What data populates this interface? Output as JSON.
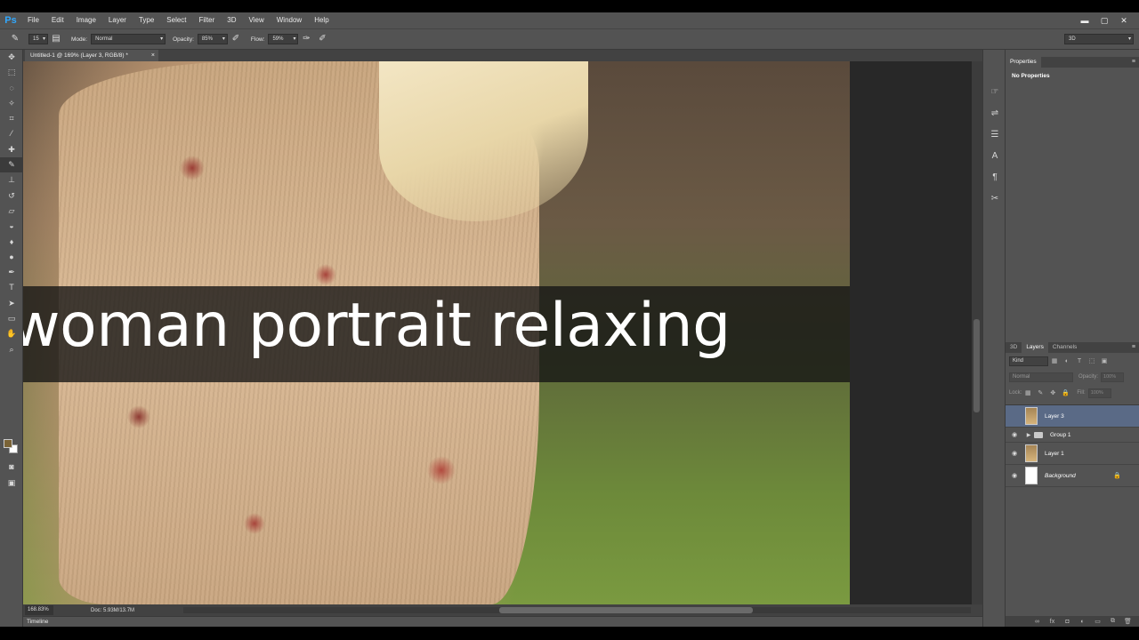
{
  "app": {
    "logo": "Ps"
  },
  "menu": [
    "File",
    "Edit",
    "Image",
    "Layer",
    "Type",
    "Select",
    "Filter",
    "3D",
    "View",
    "Window",
    "Help"
  ],
  "window_controls": [
    "▬",
    "▢",
    "✕"
  ],
  "options": {
    "brush_size": "15",
    "mode_label": "Mode:",
    "mode_value": "Normal",
    "opacity_label": "Opacity:",
    "opacity_value": "85%",
    "flow_label": "Flow:",
    "flow_value": "59%",
    "workspace": "3D"
  },
  "document": {
    "tab_title": "Untitled-1 @ 169% (Layer 3, RGB/8) *",
    "caption": "woman portrait relaxing"
  },
  "status": {
    "zoom": "168.83%",
    "doc_size": "Doc: 5.93M/13.7M"
  },
  "timeline": {
    "label": "Timeline"
  },
  "properties": {
    "tab": "Properties",
    "empty_text": "No Properties"
  },
  "layers_panel": {
    "tabs": [
      "3D",
      "Layers",
      "Channels"
    ],
    "filter_kind": "Kind",
    "blend_mode": "Normal",
    "opacity_label": "Opacity:",
    "opacity_value": "100%",
    "lock_label": "Lock:",
    "fill_label": "Fill:",
    "fill_value": "100%",
    "layers": [
      {
        "name": "Layer 3",
        "selected": true,
        "visible": false
      },
      {
        "name": "Group 1",
        "group": true,
        "visible": true
      },
      {
        "name": "Layer 1",
        "visible": true
      },
      {
        "name": "Background",
        "visible": true,
        "locked": true
      }
    ]
  },
  "colors": {
    "foreground": "#7a6336",
    "background": "#ffffff",
    "selection": "#5a6a86"
  }
}
